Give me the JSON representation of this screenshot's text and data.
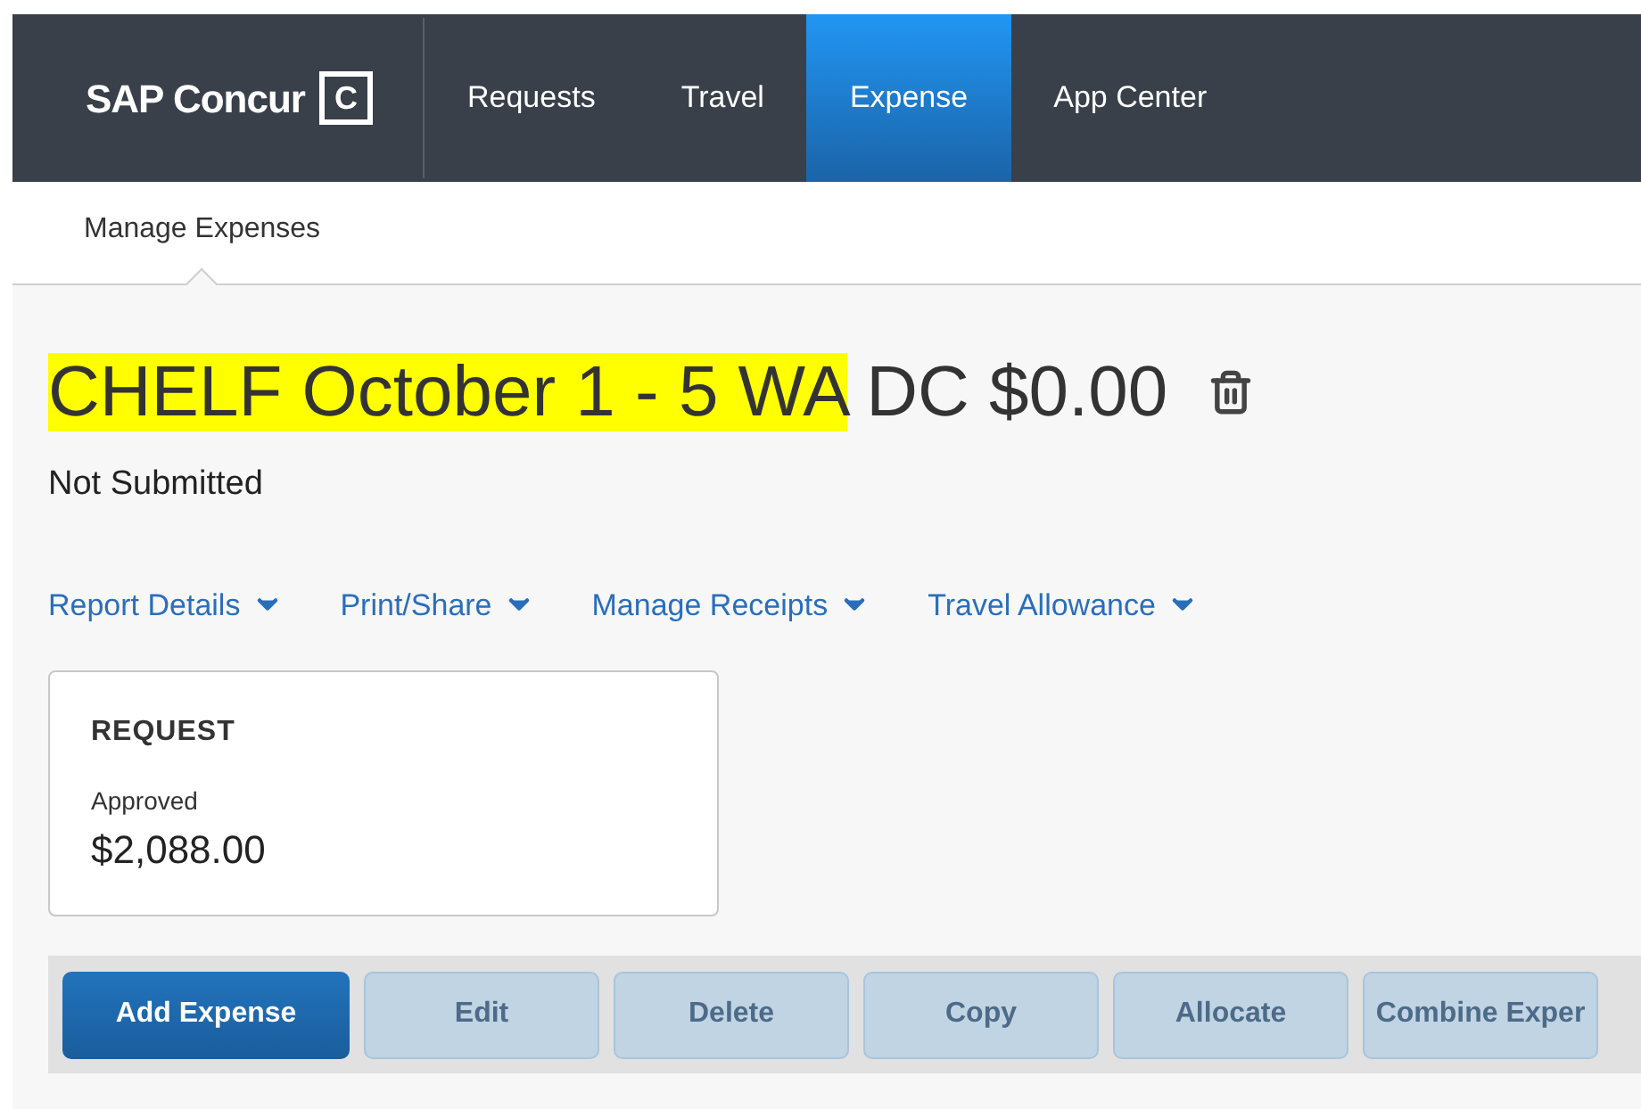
{
  "brand": {
    "name": "SAP Concur",
    "mark": "C"
  },
  "nav": [
    {
      "label": "Requests",
      "selected": false
    },
    {
      "label": "Travel",
      "selected": false
    },
    {
      "label": "Expense",
      "selected": true
    },
    {
      "label": "App Center",
      "selected": false
    }
  ],
  "subnav": [
    {
      "label": "Manage Expenses",
      "selected": true
    }
  ],
  "report": {
    "title": [
      {
        "text": "CHELF October 1 - 5 WA",
        "highlighted": true
      },
      {
        "text": " DC $0.00",
        "highlighted": false
      }
    ],
    "status": "Not Submitted"
  },
  "menus": [
    "Report Details",
    "Print/Share",
    "Manage Receipts",
    "Travel Allowance"
  ],
  "request_card": {
    "heading": "REQUEST",
    "status": "Approved",
    "amount": "$2,088.00"
  },
  "buttons": [
    {
      "label": "Add Expense",
      "disabled": false
    },
    {
      "label": "Edit",
      "disabled": true
    },
    {
      "label": "Delete",
      "disabled": true
    },
    {
      "label": "Copy",
      "disabled": true
    },
    {
      "label": "Allocate",
      "disabled": true
    },
    {
      "label": "Combine Exper",
      "disabled": true
    }
  ]
}
